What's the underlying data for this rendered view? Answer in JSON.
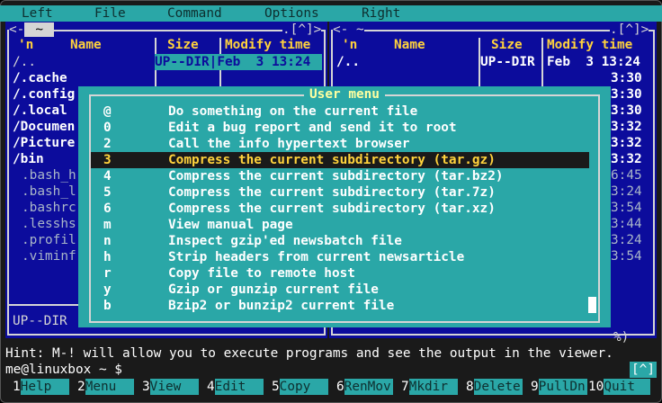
{
  "menubar": {
    "left": "Left",
    "file": "File",
    "command": "Command",
    "options": "Options",
    "right": "Right"
  },
  "left_panel": {
    "tilde": "~",
    "corner": ".[^]>",
    "sort": "'n",
    "col_name": "Name",
    "col_size": "Size",
    "col_mtime": "Modify time",
    "updir_name": "/..",
    "updir_size": "UP--DIR",
    "updir_time": "Feb  3 13:24",
    "entries": [
      "/.cache",
      "/.config",
      "/.local",
      "/Documen",
      "/Picture",
      "/bin",
      ".bash_h",
      ".bash_l",
      ".bashrc",
      ".lesshs",
      ".profil",
      ".viminf"
    ],
    "status": "UP--DIR"
  },
  "right_panel": {
    "corner": ".[^]>",
    "sort": "'n",
    "col_name": "Name",
    "col_size": "Size",
    "col_mtime": "Modify time",
    "updir_name": "/..",
    "updir_size": "UP--DIR",
    "updir_time": "Feb  3 13:24",
    "times": [
      "3:30",
      "3:30",
      "3:30",
      "3:32",
      "3:32",
      "3:32",
      "6:45",
      "3:24",
      "3:54",
      "3:44",
      "3:24",
      "3:54"
    ],
    "status": "%)"
  },
  "user_menu": {
    "title": "User menu",
    "items": [
      {
        "key": "@",
        "text": "Do something on the current file"
      },
      {
        "key": "0",
        "text": "Edit a bug report and send it to root"
      },
      {
        "key": "2",
        "text": "Call the info hypertext browser"
      },
      {
        "key": "3",
        "text": "Compress the current subdirectory (tar.gz)"
      },
      {
        "key": "4",
        "text": "Compress the current subdirectory (tar.bz2)"
      },
      {
        "key": "5",
        "text": "Compress the current subdirectory (tar.7z)"
      },
      {
        "key": "6",
        "text": "Compress the current subdirectory (tar.xz)"
      },
      {
        "key": "m",
        "text": "View manual page"
      },
      {
        "key": "n",
        "text": "Inspect gzip'ed newsbatch file"
      },
      {
        "key": "h",
        "text": "Strip headers from current newsarticle"
      },
      {
        "key": "r",
        "text": "Copy file to remote host"
      },
      {
        "key": "y",
        "text": "Gzip or gunzip current file"
      },
      {
        "key": "b",
        "text": "Bzip2 or bunzip2 current file"
      }
    ],
    "selected_key": "3"
  },
  "hint": "Hint: M-! will allow you to execute programs and see the output in the viewer.",
  "prompt": "me@linuxbox ~ $",
  "prompt_corner": "[^]",
  "fkeys": [
    {
      "num": "1",
      "label": "Help"
    },
    {
      "num": "2",
      "label": "Menu"
    },
    {
      "num": "3",
      "label": "View"
    },
    {
      "num": "4",
      "label": "Edit"
    },
    {
      "num": "5",
      "label": "Copy"
    },
    {
      "num": "6",
      "label": "RenMov"
    },
    {
      "num": "7",
      "label": "Mkdir"
    },
    {
      "num": "8",
      "label": "Delete"
    },
    {
      "num": "9",
      "label": "PullDn"
    },
    {
      "num": "10",
      "label": "Quit"
    }
  ],
  "colors": {
    "panel_bg": "#0c0c9c",
    "accent_cyan": "#2aa7a7",
    "header_yellow": "#ffd23c"
  }
}
